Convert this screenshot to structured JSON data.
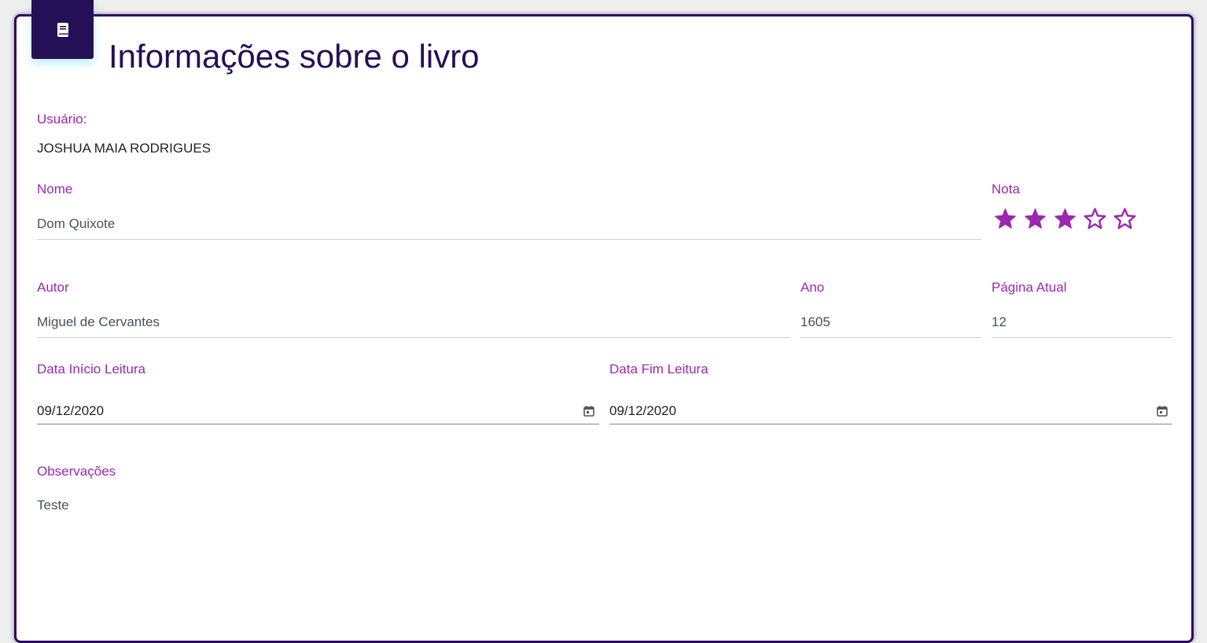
{
  "header": {
    "title": "Informações sobre o livro",
    "icon": "book-icon"
  },
  "user": {
    "label": "Usuário:",
    "value": "JOSHUA MAIA RODRIGUES"
  },
  "form": {
    "name": {
      "label": "Nome",
      "value": "Dom Quixote"
    },
    "rating": {
      "label": "Nota",
      "value": 3,
      "max": 5
    },
    "author": {
      "label": "Autor",
      "value": "Miguel de Cervantes"
    },
    "year": {
      "label": "Ano",
      "value": "1605"
    },
    "current_page": {
      "label": "Página Atual",
      "value": "12"
    },
    "start_date": {
      "label": "Data Início Leitura",
      "value": "09/12/2020"
    },
    "end_date": {
      "label": "Data Fim Leitura",
      "value": "09/12/2020"
    },
    "notes": {
      "label": "Observações",
      "value": "Teste"
    }
  },
  "colors": {
    "primary_dark": "#241057",
    "accent": "#9c27b0"
  }
}
